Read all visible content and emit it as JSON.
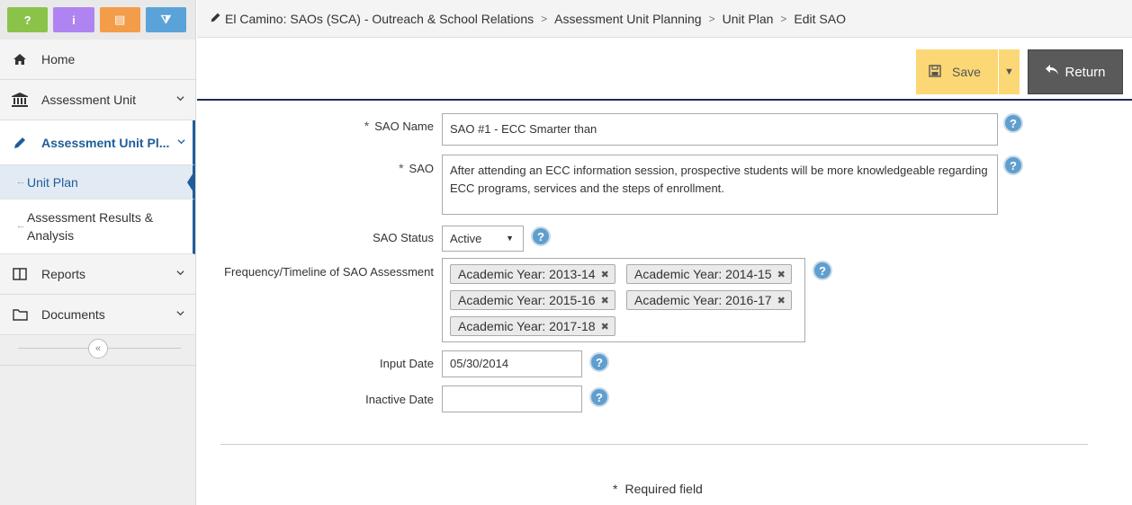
{
  "sidebar": {
    "top_buttons": [
      {
        "label": "?",
        "color": "#8bc34a",
        "icon": "question-icon"
      },
      {
        "label": "i",
        "color": "#b084f0",
        "icon": "info-icon"
      },
      {
        "label": "▤",
        "color": "#f39c4a",
        "icon": "list-icon"
      },
      {
        "label": "⧩",
        "color": "#5aa3d8",
        "icon": "filter-icon"
      }
    ],
    "nav": {
      "home": {
        "label": "Home",
        "icon": "home-icon"
      },
      "assessment_unit": {
        "label": "Assessment Unit",
        "icon": "institution-icon"
      },
      "assessment_unit_planning": {
        "label": "Assessment Unit Pl...",
        "icon": "pencil-icon"
      },
      "unit_plan": {
        "label": "Unit Plan"
      },
      "results": {
        "label": "Assessment Results & Analysis"
      },
      "reports": {
        "label": "Reports",
        "icon": "columns-icon"
      },
      "documents": {
        "label": "Documents",
        "icon": "folder-icon"
      },
      "collapse": "«"
    }
  },
  "breadcrumb": {
    "items": [
      "El Camino: SAOs (SCA) - Outreach & School Relations",
      "Assessment Unit Planning",
      "Unit Plan",
      "Edit SAO"
    ],
    "separator": ">"
  },
  "toolbar": {
    "save_label": "Save",
    "return_label": "Return"
  },
  "form": {
    "sao_name": {
      "label": "SAO Name",
      "value": "SAO #1 - ECC Smarter than"
    },
    "sao": {
      "label": "SAO",
      "value": "After attending an ECC information session, prospective students will be more knowledgeable regarding ECC programs, services and the steps of enrollment."
    },
    "sao_status": {
      "label": "SAO Status",
      "value": "Active"
    },
    "frequency": {
      "label": "Frequency/Timeline of SAO Assessment",
      "tags": [
        "Academic Year: 2013-14",
        "Academic Year: 2014-15",
        "Academic Year: 2015-16",
        "Academic Year: 2016-17",
        "Academic Year: 2017-18"
      ]
    },
    "input_date": {
      "label": "Input Date",
      "value": "05/30/2014"
    },
    "inactive_date": {
      "label": "Inactive Date",
      "value": ""
    },
    "required_mark": "*",
    "required_note": "Required field"
  },
  "colors": {
    "accent": "#1f5d99",
    "save": "#fbd775",
    "return": "#5a5a5a",
    "help": "#5f9fcf"
  }
}
